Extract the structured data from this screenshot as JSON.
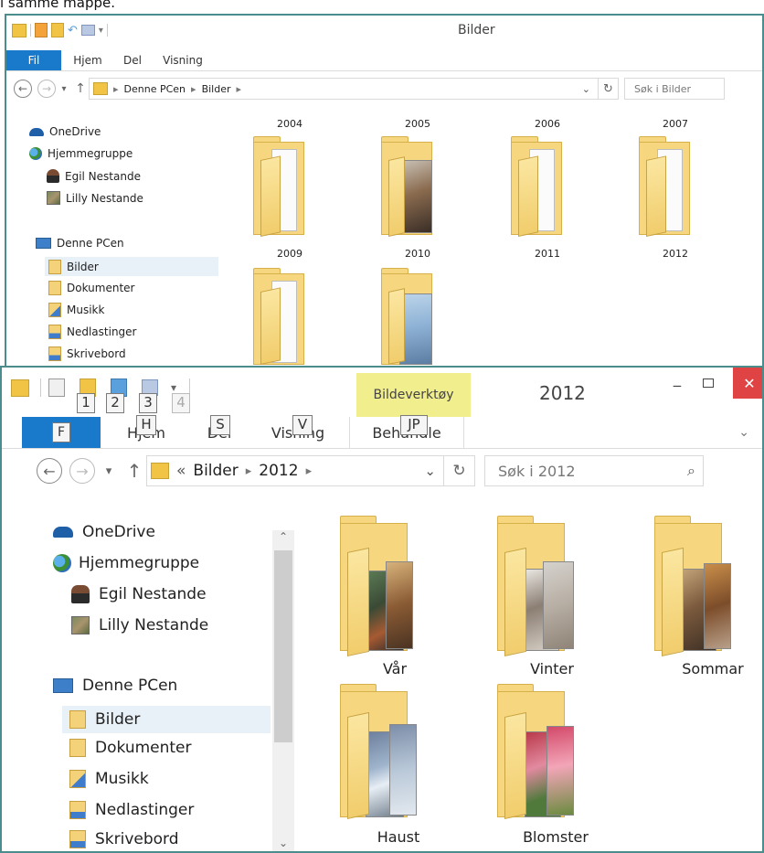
{
  "caption": "i samme mappe.",
  "top_window": {
    "title": "Bilder",
    "ribbon_tabs": [
      "Fil",
      "Hjem",
      "Del",
      "Visning"
    ],
    "breadcrumb": [
      "Denne PCen",
      "Bilder"
    ],
    "search_placeholder": "Søk i Bilder",
    "nav": [
      "OneDrive",
      "Hjemmegruppe",
      "Egil Nestande",
      "Lilly Nestande",
      "Denne PCen",
      "Bilder",
      "Dokumenter",
      "Musikk",
      "Nedlastinger",
      "Skrivebord"
    ],
    "folders_row0": [
      "2004",
      "2005",
      "2006",
      "2007"
    ],
    "folders_row1": [
      "2009",
      "2010",
      "2011",
      "2012"
    ]
  },
  "bottom_window": {
    "title": "2012",
    "contextual_tab": "Bildeverktøy",
    "ribbon_tabs": [
      "F",
      "Hjem",
      "Del",
      "Visning",
      "Behandle"
    ],
    "keytips_qat": [
      "1",
      "2",
      "3",
      "4"
    ],
    "keytips_ribbon": [
      "H",
      "S",
      "V",
      "JP"
    ],
    "breadcrumb": [
      "«",
      "Bilder",
      "2012"
    ],
    "search_placeholder": "Søk i 2012",
    "nav": [
      "OneDrive",
      "Hjemmegruppe",
      "Egil Nestande",
      "Lilly Nestande",
      "Denne PCen",
      "Bilder",
      "Dokumenter",
      "Musikk",
      "Nedlastinger",
      "Skrivebord"
    ],
    "folders": [
      "Vår",
      "Vinter",
      "Sommar",
      "Haust",
      "Blomster"
    ]
  },
  "colors": {
    "accent": "#1979ca",
    "border": "#4a8d8c",
    "contextual": "#f1ee8e",
    "close": "#e04343"
  },
  "icons": [
    "back-icon",
    "forward-icon",
    "chevron-down-icon",
    "up-arrow-icon",
    "refresh-icon",
    "search-icon",
    "minimize-icon",
    "maximize-icon",
    "close-icon"
  ]
}
